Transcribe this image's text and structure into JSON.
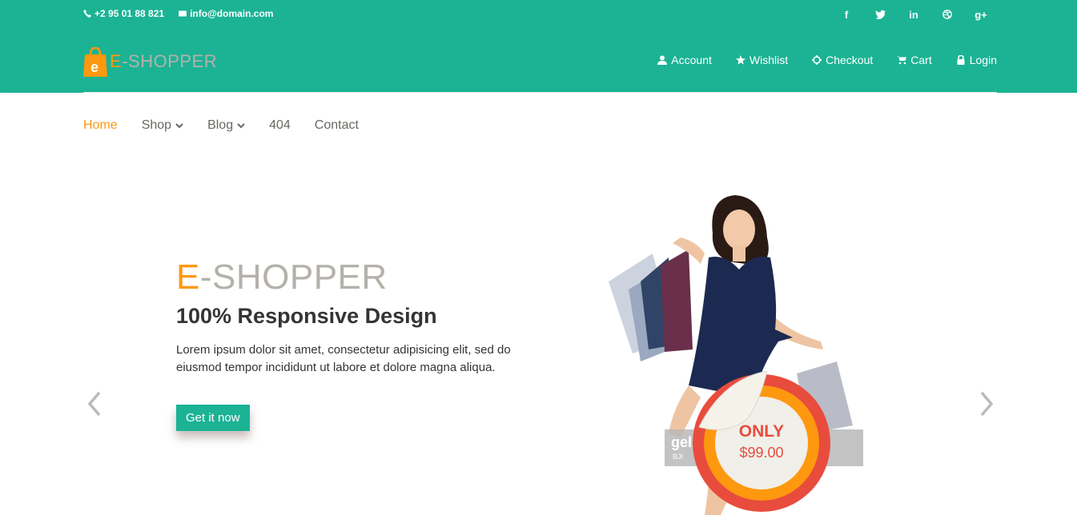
{
  "header": {
    "phone": "+2 95 01 88 821",
    "email": "info@domain.com",
    "social": [
      "f",
      "t",
      "in",
      "dribbble",
      "g+"
    ],
    "logo": {
      "e": "E",
      "rest": "-SHOPPER"
    },
    "user_menu": [
      {
        "label": "Account",
        "icon": "user-icon"
      },
      {
        "label": "Wishlist",
        "icon": "star-icon"
      },
      {
        "label": "Checkout",
        "icon": "crosshair-icon"
      },
      {
        "label": "Cart",
        "icon": "cart-icon"
      },
      {
        "label": "Login",
        "icon": "lock-icon"
      }
    ]
  },
  "nav": {
    "home": "Home",
    "shop": "Shop",
    "blog": "Blog",
    "notfound": "404",
    "contact": "Contact"
  },
  "slider": {
    "brand_e": "E",
    "brand_rest": "-SHOPPER",
    "headline": "100% Responsive Design",
    "description": "Lorem ipsum dolor sit amet, consectetur adipisicing elit, sed do eiusmod tempor incididunt ut labore et dolore magna aliqua.",
    "cta": "Get it now",
    "badge_top": "ONLY",
    "badge_price": "$99.00",
    "strip_text": "gel",
    "strip_sub": "BJI"
  },
  "colors": {
    "brand_green": "#1bb394",
    "brand_orange": "#fe980f",
    "badge_red": "#e84c3d"
  }
}
